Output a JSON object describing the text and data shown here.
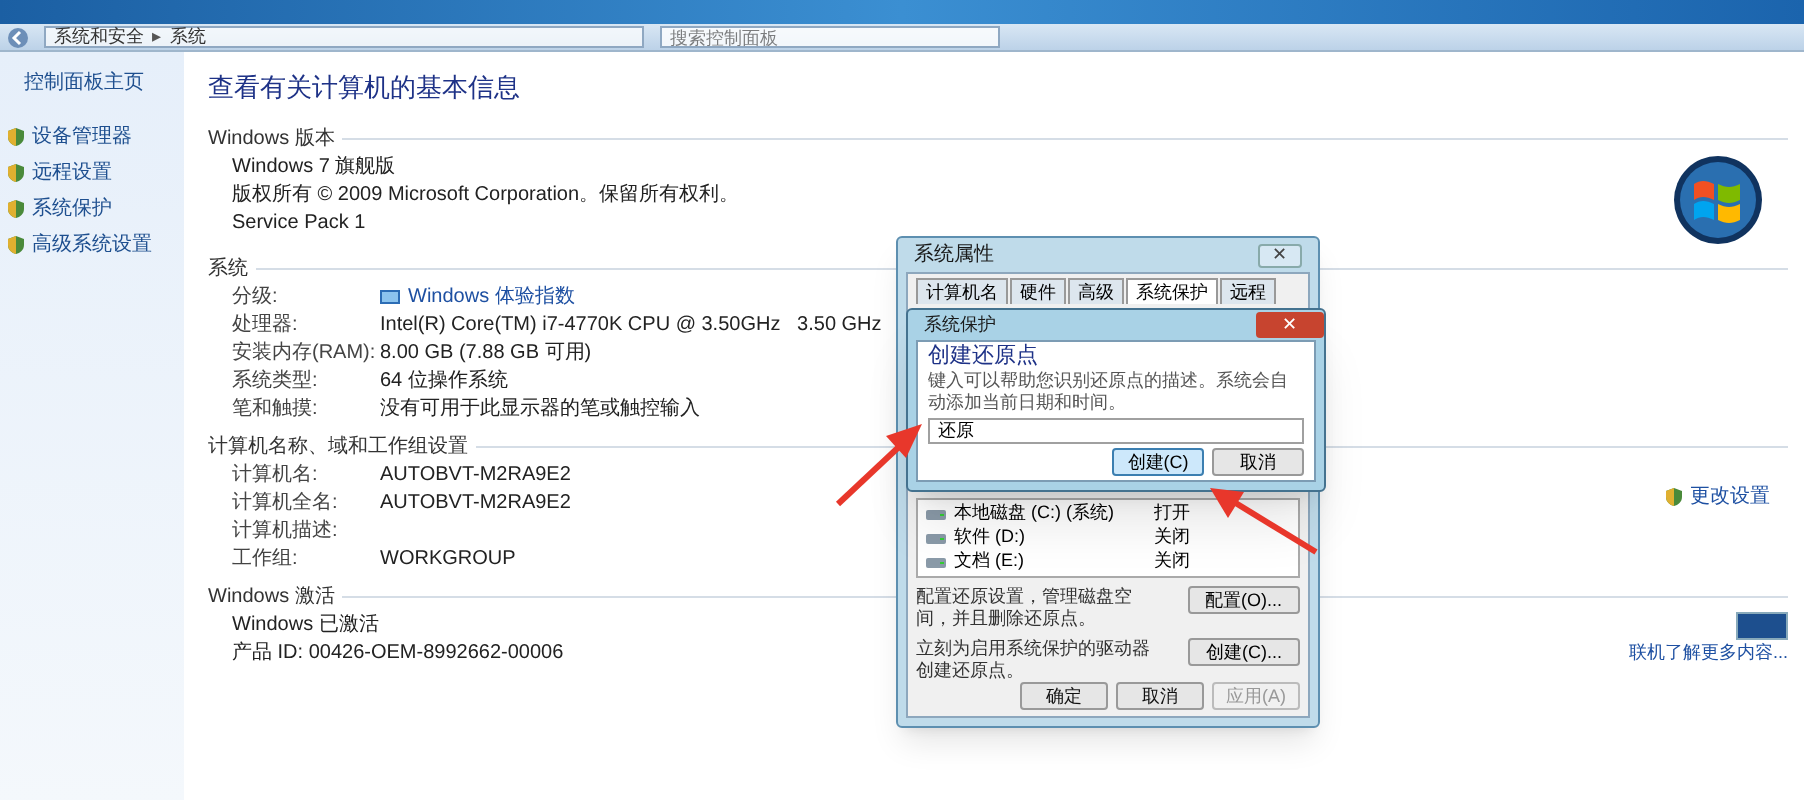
{
  "window": {
    "breadcrumb": [
      "系统和安全",
      "系统"
    ],
    "separator": "▸",
    "search": {
      "placeholder": "搜索控制面板"
    }
  },
  "sidebar": {
    "home": "控制面板主页",
    "items": [
      "设备管理器",
      "远程设置",
      "系统保护",
      "高级系统设置"
    ]
  },
  "page_title": "查看有关计算机的基本信息",
  "sections": [
    {
      "heading": "Windows 版本",
      "rows": [
        {
          "kind": "text",
          "value": "Windows 7 旗舰版"
        },
        {
          "kind": "text",
          "value": "版权所有 © 2009 Microsoft Corporation。保留所有权利。"
        },
        {
          "kind": "text",
          "value": "Service Pack 1"
        }
      ]
    },
    {
      "heading": "系统",
      "rows": [
        {
          "kind": "link",
          "label": "分级:",
          "value": "Windows 体验指数"
        },
        {
          "kind": "pair",
          "label": "处理器:",
          "value": "Intel(R) Core(TM) i7-4770K CPU @ 3.50GHz   3.50 GHz"
        },
        {
          "kind": "pair",
          "label": "安装内存(RAM):",
          "value": "8.00 GB (7.88 GB 可用)"
        },
        {
          "kind": "pair",
          "label": "系统类型:",
          "value": "64 位操作系统"
        },
        {
          "kind": "pair",
          "label": "笔和触摸:",
          "value": "没有可用于此显示器的笔或触控输入"
        }
      ]
    },
    {
      "heading": "计算机名称、域和工作组设置",
      "action": "更改设置",
      "rows": [
        {
          "kind": "pair",
          "label": "计算机名:",
          "value": "AUTOBVT-M2RA9E2"
        },
        {
          "kind": "pair",
          "label": "计算机全名:",
          "value": "AUTOBVT-M2RA9E2"
        },
        {
          "kind": "pair",
          "label": "计算机描述:",
          "value": ""
        },
        {
          "kind": "pair",
          "label": "工作组:",
          "value": "WORKGROUP"
        }
      ]
    },
    {
      "heading": "Windows 激活",
      "badge_link": "联机了解更多内容...",
      "rows": [
        {
          "kind": "text",
          "value": "Windows 已激活"
        },
        {
          "kind": "text",
          "value": "产品 ID: 00426-OEM-8992662-00006"
        }
      ]
    }
  ],
  "dialog": {
    "title": "系统属性",
    "close": "✕",
    "tabs": [
      {
        "label": "计算机名",
        "selected": false
      },
      {
        "label": "硬件",
        "selected": false
      },
      {
        "label": "高级",
        "selected": false
      },
      {
        "label": "系统保护",
        "selected": true
      },
      {
        "label": "远程",
        "selected": false
      }
    ],
    "drives": [
      {
        "name": "本地磁盘 (C:) (系统)",
        "protection": "打开"
      },
      {
        "name": "软件 (D:)",
        "protection": "关闭"
      },
      {
        "name": "文档 (E:)",
        "protection": "关闭"
      }
    ],
    "configure_text": "配置还原设置，管理磁盘空间，并且删除还原点。",
    "configure_button": "配置(O)...",
    "create_text": "立刻为启用系统保护的驱动器创建还原点。",
    "create_button": "创建(C)...",
    "buttons": [
      {
        "label": "确定",
        "disabled": false
      },
      {
        "label": "取消",
        "disabled": false
      },
      {
        "label": "应用(A)",
        "disabled": true
      }
    ]
  },
  "restore_dialog": {
    "title": "系统保护",
    "close": "✕",
    "heading": "创建还原点",
    "description": "键入可以帮助您识别还原点的描述。系统会自动添加当前日期和时间。",
    "input": {
      "value": "还原"
    },
    "buttons": [
      {
        "label": "创建(C)",
        "default": true
      },
      {
        "label": "取消",
        "default": false
      }
    ]
  }
}
